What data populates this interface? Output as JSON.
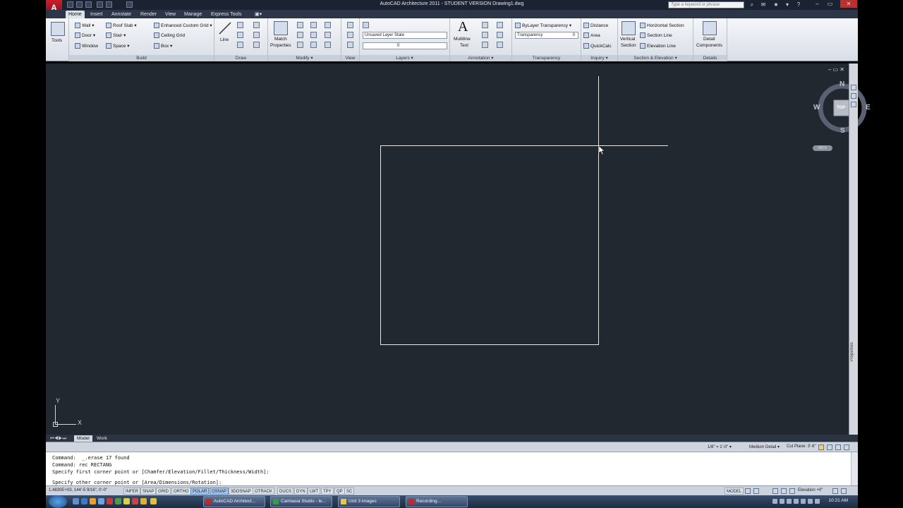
{
  "app": {
    "title": "AutoCAD Architecture 2011 - STUDENT VERSION    Drawing1.dwg",
    "logo_letter": "A",
    "search_placeholder": "Type a keyword or phrase"
  },
  "tabs": [
    {
      "label": "Home",
      "active": true
    },
    {
      "label": "Insert"
    },
    {
      "label": "Annotate"
    },
    {
      "label": "Render"
    },
    {
      "label": "View"
    },
    {
      "label": "Manage"
    },
    {
      "label": "Express Tools"
    }
  ],
  "ribbon": {
    "tools": {
      "label": "Tools"
    },
    "build": {
      "label": "Build",
      "wall": "Wall",
      "door": "Door",
      "window": "Window",
      "roof_slab": "Roof Slab",
      "stair": "Stair",
      "space": "Space",
      "grid": "Enhanced Custom Grid",
      "ceiling_grid": "Ceiling Grid",
      "box": "Box"
    },
    "draw": {
      "label": "Draw",
      "line": "Line"
    },
    "modify": {
      "label": "Modify",
      "match": "Match",
      "properties": "Properties"
    },
    "view": {
      "label": "View"
    },
    "layers": {
      "label": "Layers",
      "layer_state": "Unsaved Layer State",
      "current_layer": "0"
    },
    "annotation": {
      "label": "Annotation",
      "multiline": "Multiline",
      "text": "Text"
    },
    "transparency": {
      "label": "Transparency",
      "bylayer": "ByLayer Transparency",
      "field": "Transparency",
      "value": "0"
    },
    "inquiry": {
      "label": "Inquiry",
      "distance": "Distance",
      "area": "Area",
      "quickcalc": "QuickCalc"
    },
    "section": {
      "label": "Section & Elevation",
      "vertical": "Vertical",
      "section": "Section",
      "horizontal": "Horizontal Section",
      "section_line": "Section Line",
      "elevation_line": "Elevation Line"
    },
    "details": {
      "label": "Details",
      "detail": "Detail",
      "components": "Components"
    }
  },
  "viewcube": {
    "north": "N",
    "south": "S",
    "east": "E",
    "west": "W",
    "face": "TOP",
    "wcs": "WCS"
  },
  "right_palette": {
    "label": "Properties"
  },
  "ucs": {
    "y": "Y",
    "x": "X"
  },
  "layout_tabs": [
    {
      "label": "Model",
      "active": true
    },
    {
      "label": "Work"
    }
  ],
  "annotation_bar": {
    "scale": "1/8\" = 1'-0\"",
    "detail": "Medium Detail",
    "cut_plane": "Cut Plane: 3'-6\""
  },
  "command": {
    "history": [
      "Command:  _.erase 17 found",
      "Command: rec RECTANG",
      "Specify first corner point or [Chamfer/Elevation/Fillet/Thickness/Width]:"
    ],
    "prompt": "Specify other corner point or [Area/Dimensions/Rotation]:"
  },
  "status": {
    "coordinates": "1.4830E+03, 144'-5 9/16\", 0'-0\"",
    "toggles": [
      {
        "label": "INFER"
      },
      {
        "label": "SNAP"
      },
      {
        "label": "GRID"
      },
      {
        "label": "ORTHO"
      },
      {
        "label": "POLAR",
        "on": true
      },
      {
        "label": "OSNAP",
        "on": true
      },
      {
        "label": "3DOSNAP"
      },
      {
        "label": "OTRACK"
      },
      {
        "label": "DUCS"
      },
      {
        "label": "DYN"
      },
      {
        "label": "LWT"
      },
      {
        "label": "TPY"
      },
      {
        "label": "QP"
      },
      {
        "label": "SC"
      }
    ],
    "model": "MODEL",
    "elevation": "Elevation",
    "elevation_value": "+0\""
  },
  "taskbar": {
    "tasks": [
      {
        "label": "AutoCAD Architect...",
        "color": "#c0282e"
      },
      {
        "label": "Camtasia Studio - le...",
        "color": "#3b9a4a"
      },
      {
        "label": "Unit 3 images",
        "color": "#e6c74a"
      },
      {
        "label": "Recording...",
        "color": "#c0282e"
      }
    ],
    "clock": "10:21 AM"
  }
}
